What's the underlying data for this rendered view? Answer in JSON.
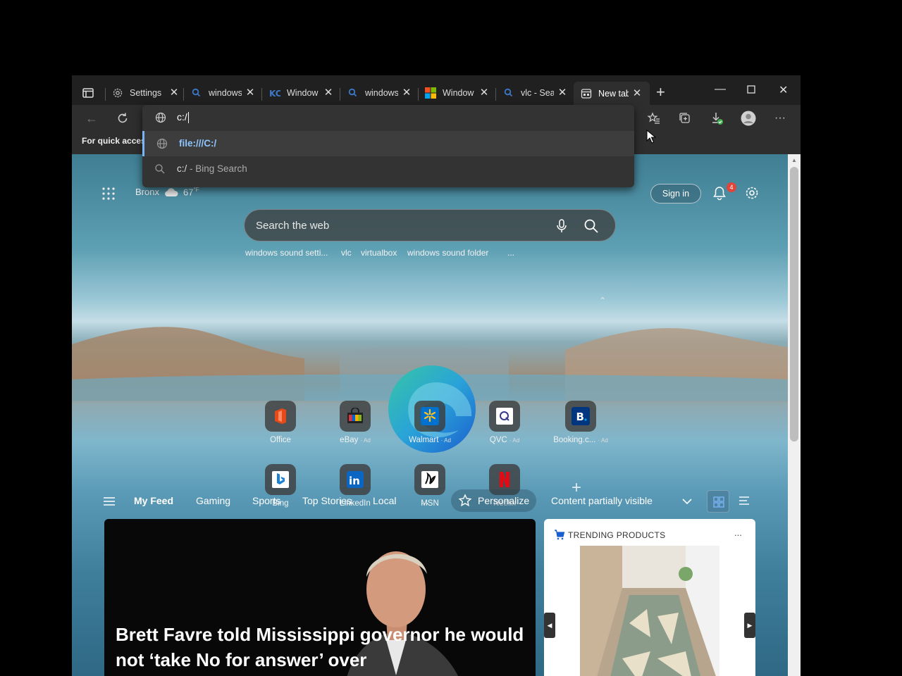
{
  "tabs": [
    {
      "title": "Settings",
      "icon": "gear-icon"
    },
    {
      "title": "windows",
      "icon": "search-icon"
    },
    {
      "title": "Window",
      "icon": "kc-logo-icon"
    },
    {
      "title": "windows",
      "icon": "search-icon"
    },
    {
      "title": "Window",
      "icon": "windows-logo-icon"
    },
    {
      "title": "vlc - Sea",
      "icon": "search-icon"
    },
    {
      "title": "New tab",
      "icon": "newtab-icon"
    }
  ],
  "favorites_bar": {
    "label": "For quick access"
  },
  "omnibox": {
    "value": "c:/",
    "suggestions": [
      {
        "text": "file:///C:/"
      },
      {
        "text": "c:/",
        "suffix": " - Bing Search"
      }
    ]
  },
  "newtab": {
    "location": "Bronx",
    "temperature": "67",
    "temp_unit": "°F",
    "sign_in": "Sign in",
    "notification_count": "4",
    "search_placeholder": "Search the web",
    "trending": [
      "windows sound setti...",
      "vlc",
      "virtualbox",
      "windows sound folder"
    ],
    "trending_more": "...",
    "tiles": [
      {
        "label": "Office",
        "ad": ""
      },
      {
        "label": "eBay",
        "ad": "· Ad"
      },
      {
        "label": "Walmart",
        "ad": "· Ad"
      },
      {
        "label": "QVC",
        "ad": "· Ad"
      },
      {
        "label": "Booking.c...",
        "ad": "· Ad"
      },
      {
        "label": "Bing",
        "ad": ""
      },
      {
        "label": "LinkedIn",
        "ad": ""
      },
      {
        "label": "MSN",
        "ad": ""
      },
      {
        "label": "Netflix",
        "ad": ""
      }
    ],
    "feed_nav": [
      "My Feed",
      "Gaming",
      "Sports",
      "Top Stories",
      "Local"
    ],
    "feed_more": "...",
    "personalize": "Personalize",
    "visibility": "Content partially visible",
    "headline": "Brett Favre told Mississippi governor he would not ‘take No for answer’ over",
    "trending_products": "TRENDING PRODUCTS",
    "trending_products_more": "..."
  },
  "colors": {
    "accent": "#7ab4f5",
    "badge": "#e0453a",
    "chrome_dark": "#202020",
    "toolbar": "#2e2e2e"
  }
}
